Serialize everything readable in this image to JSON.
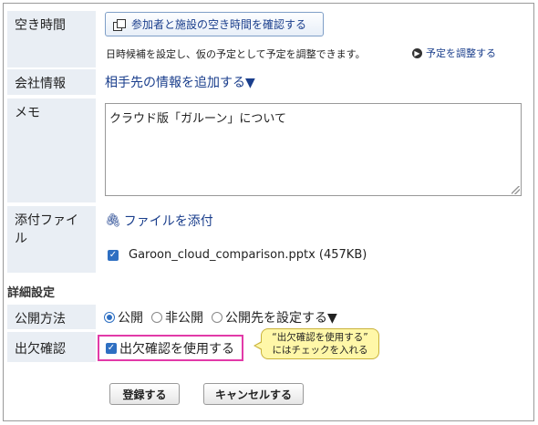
{
  "labels": {
    "free_time": "空き時間",
    "company": "会社情報",
    "memo": "メモ",
    "attachment": "添付ファイル",
    "details": "詳細設定",
    "publish": "公開方法",
    "attendance": "出欠確認"
  },
  "free_time": {
    "button": "参加者と施設の空き時間を確認する",
    "note": "日時候補を設定し、仮の予定として予定を調整できます。",
    "adjust_link": "予定を調整する"
  },
  "company": {
    "link": "相手先の情報を追加する▼"
  },
  "memo": {
    "value": "クラウド版「ガルーン」について"
  },
  "attachment": {
    "link": "ファイルを添付",
    "file": "Garoon_cloud_comparison.pptx (457KB)"
  },
  "publish": {
    "options": [
      "公開",
      "非公開",
      "公開先を設定する▼"
    ],
    "selected": "公開"
  },
  "attendance": {
    "checkbox_label": "出欠確認を使用する",
    "checked": true,
    "callout_line1": "“出欠確認を使用する”",
    "callout_line2": "にはチェックを入れる"
  },
  "buttons": {
    "submit": "登録する",
    "cancel": "キャンセルする"
  },
  "colors": {
    "accent": "#2e6fc2",
    "link": "#1a3e8c",
    "label_bg": "#e9eef4",
    "highlight": "#e23aa8",
    "callout_bg": "#fff7a8"
  }
}
